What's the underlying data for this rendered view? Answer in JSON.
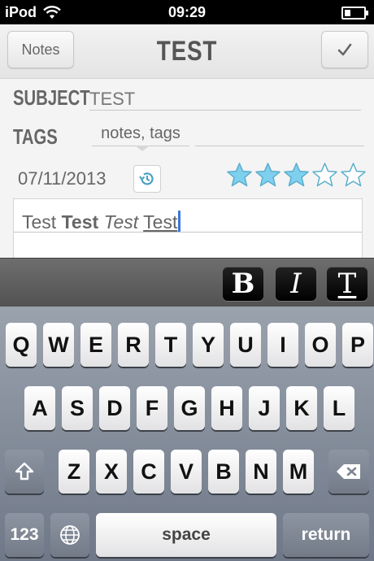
{
  "status_bar": {
    "carrier": "iPod",
    "time": "09:29",
    "icons": [
      "wifi-icon",
      "battery-icon"
    ]
  },
  "nav": {
    "back_label": "Notes",
    "title": "TEST",
    "done_icon": "checkmark-icon"
  },
  "form": {
    "subject_label": "SUBJECT",
    "subject_value": "TEST",
    "tags_label": "TAGS",
    "tags_value": "notes, tags",
    "date": "07/11/2013",
    "history_icon": "history-icon",
    "rating": {
      "filled": 3,
      "total": 5
    },
    "colors": {
      "star_fill": "#7fd0ef",
      "star_outline": "#5aaecb",
      "cursor": "#3a77d8"
    }
  },
  "editor": {
    "segments": [
      {
        "text": "Test",
        "style": "normal"
      },
      {
        "text": "Test",
        "style": "bold"
      },
      {
        "text": "Test",
        "style": "italic"
      },
      {
        "text": "Test",
        "style": "underline"
      }
    ]
  },
  "format_bar": {
    "bold_label": "B",
    "italic_label": "I",
    "underline_label": "T"
  },
  "keyboard": {
    "row1": [
      "Q",
      "W",
      "E",
      "R",
      "T",
      "Y",
      "U",
      "I",
      "O",
      "P"
    ],
    "row2": [
      "A",
      "S",
      "D",
      "F",
      "G",
      "H",
      "J",
      "K",
      "L"
    ],
    "row3": [
      "Z",
      "X",
      "C",
      "V",
      "B",
      "N",
      "M"
    ],
    "numbers_label": "123",
    "space_label": "space",
    "return_label": "return",
    "icons": [
      "shift-icon",
      "backspace-icon",
      "globe-icon"
    ]
  }
}
